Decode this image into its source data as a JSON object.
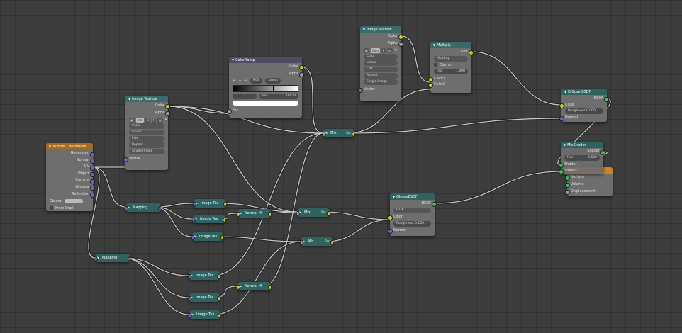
{
  "texture_coordinate": {
    "title": "Texture Coordinate",
    "outputs": [
      "Generated",
      "Normal",
      "UV",
      "Object",
      "Camera",
      "Window",
      "Reflection"
    ],
    "object_label": "Object:",
    "from_dupli": "From Dupli"
  },
  "image_texture_1": {
    "title": "Image Texture",
    "outputs": [
      "Color",
      "Alpha"
    ],
    "image_name": "Ima",
    "users": "2",
    "fake": "F",
    "color": "Color",
    "interpolation": "Linear",
    "projection": "Flat",
    "extension": "Repeat",
    "source": "Single Image",
    "input": "Vector"
  },
  "color_ramp": {
    "title": "ColorRamp",
    "outputs": [
      "Color",
      "Alpha"
    ],
    "add": "+",
    "remove": "−",
    "flip": "↔",
    "mode": "RGB",
    "interp": "Linear",
    "index": "1",
    "pos_label": "Pos",
    "pos_value": "0.623",
    "input": "Fac"
  },
  "image_texture_2": {
    "title": "Image Texture",
    "outputs": [
      "Color",
      "Alpha"
    ],
    "image_name": "Cam",
    "fake": "F",
    "color": "Color",
    "interpolation": "Linear",
    "projection": "Flat",
    "extension": "Repeat",
    "source": "Single Image",
    "input": "Vector"
  },
  "multiply": {
    "title": "Multiply",
    "output": "Color",
    "blend": "Multiply",
    "clamp": "Clamp",
    "fac_label": "Fac:",
    "fac_value": "1.000",
    "inputs": [
      "Color1",
      "Color2"
    ]
  },
  "diffuse": {
    "title": "Diffuse BSDF",
    "output": "BSDF",
    "color": "Color",
    "roughness": "Roughness 0.000",
    "normal": "Normal"
  },
  "mix_shader": {
    "title": "MixShader",
    "output": "Shader",
    "fac_label": "Fac:",
    "fac_value": "0.500",
    "inputs": [
      "Shader",
      "Shader"
    ]
  },
  "material_output": {
    "inputs": [
      "Surface",
      "Volume",
      "Displacement"
    ]
  },
  "glossy": {
    "title": "GlossyBSDF",
    "output": "BSDF",
    "distribution": "GGX",
    "color": "Color",
    "roughness": "Roughness 0.200",
    "normal": "Normal"
  },
  "mapping_1": "Mapping",
  "mapping_2": "Mapping",
  "image_tex_small": [
    "Image Tex",
    "Image Tex",
    "Image Tex",
    "Image Tex",
    "Image Tex",
    "Image Tex"
  ],
  "normal_mix": [
    "Normal Mi",
    "Normal Mi"
  ],
  "mix_nodes": [
    "Mix",
    "Mix",
    "Mix"
  ],
  "mix_fac": "Fac",
  "colors": {
    "texture_header": "#3c6b6b",
    "converter_header": "#4c4c63",
    "input_header": "#a66a22",
    "color_socket": "#cdcd2a",
    "float_socket": "#a0a0a0",
    "vector_socket": "#6f63c9",
    "shader_socket": "#44c25c",
    "wire": "#c8c8c8"
  }
}
